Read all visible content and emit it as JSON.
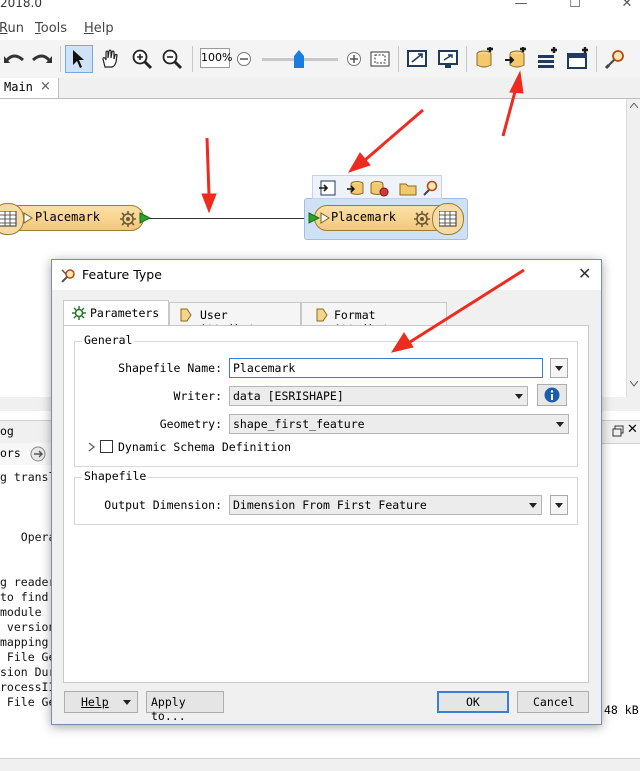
{
  "window": {
    "title": "2018.0",
    "controls": [
      "—",
      "☐",
      "✕"
    ]
  },
  "menu": {
    "items": [
      {
        "label": "Run",
        "mnemonic": "R"
      },
      {
        "label": "Tools",
        "mnemonic": "T"
      },
      {
        "label": "Help",
        "mnemonic": "H"
      }
    ]
  },
  "toolbar": {
    "zoom_value": "100%"
  },
  "tabs": {
    "main_label": "Main",
    "close_glyph": "×"
  },
  "canvas": {
    "reader_node_label": "Placemark",
    "writer_node_label": "Placemark",
    "arrow_color": "#ee2b1f"
  },
  "log": {
    "header_fragment": "og",
    "toolbar_fragment": "ors",
    "lines": [
      "g transl",
      "",
      "",
      "",
      "   Opera",
      "",
      "",
      "g reader",
      "to find",
      "module",
      " version",
      "mapping",
      " File Ge",
      "sion Dur",
      "rocessII",
      " File Generation was SUCCESSFUL"
    ],
    "right_fragment": "48 kB"
  },
  "dialog": {
    "title": "Feature Type",
    "close_glyph": "✕",
    "tabs": [
      {
        "label": "Parameters",
        "icon": "gear-icon"
      },
      {
        "label": "User Attributes",
        "icon": "tag-arrow-icon"
      },
      {
        "label": "Format Attributes",
        "icon": "tag-arrow-icon"
      }
    ],
    "general": {
      "title": "General",
      "shapefile_name_label": "Shapefile Name:",
      "shapefile_name_value": "Placemark",
      "writer_label": "Writer:",
      "writer_value": "data [ESRISHAPE]",
      "geometry_label": "Geometry:",
      "geometry_value": "shape_first_feature",
      "dynamic_schema_label": "Dynamic Schema Definition"
    },
    "shapefile": {
      "title": "Shapefile",
      "output_dimension_label": "Output Dimension:",
      "output_dimension_value": "Dimension From First Feature"
    },
    "buttons": {
      "help": "Help",
      "apply_to": "Apply to...",
      "ok": "OK",
      "cancel": "Cancel"
    }
  }
}
